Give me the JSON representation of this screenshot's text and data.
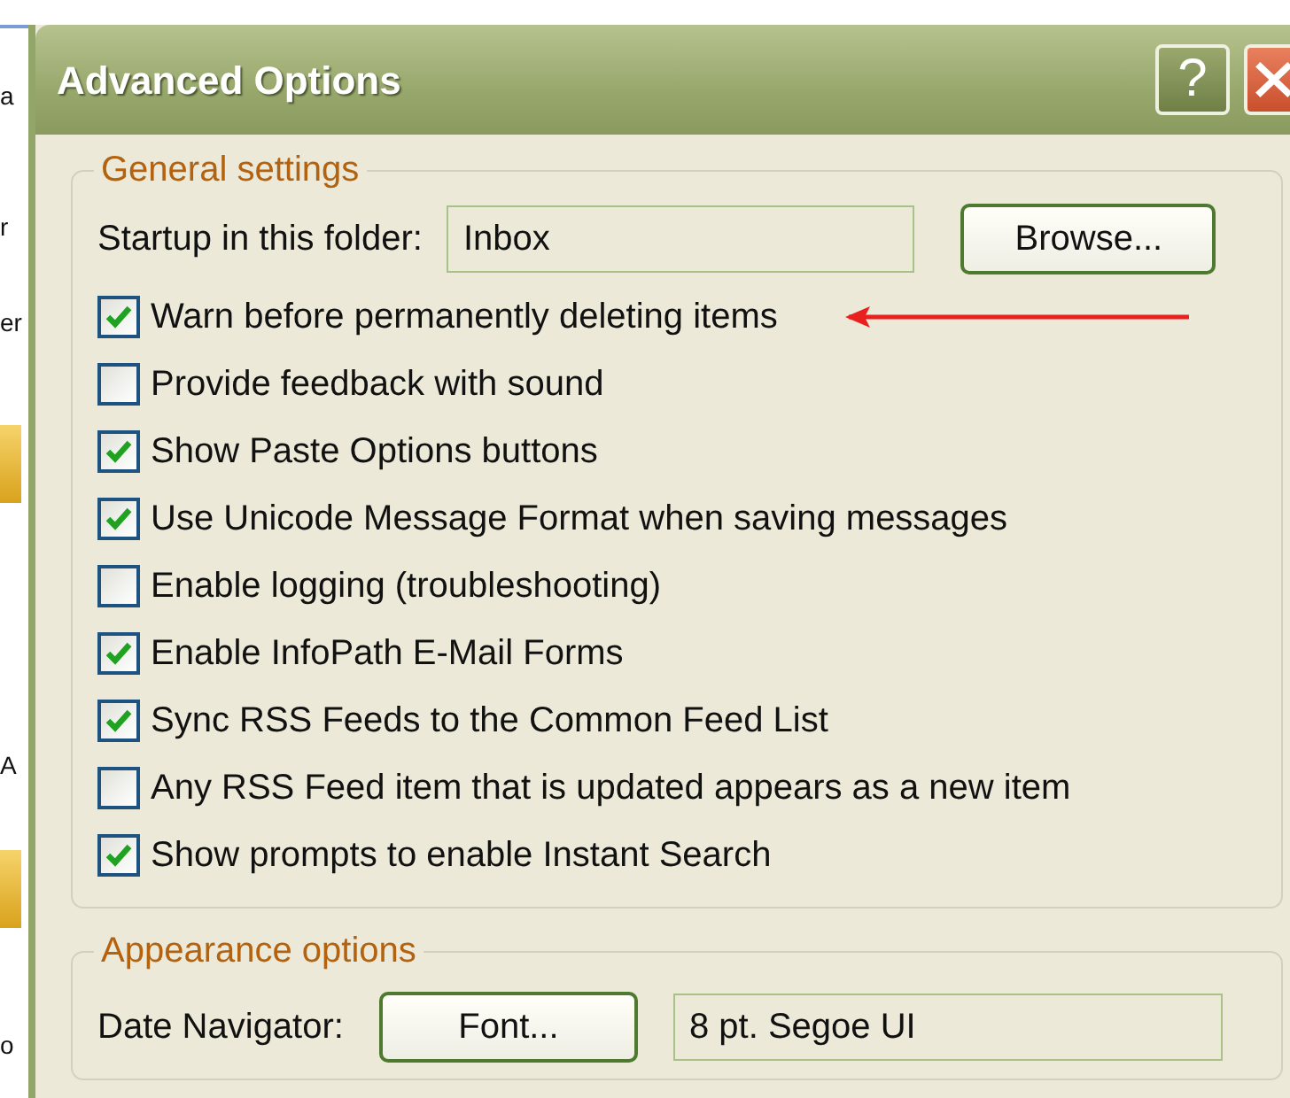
{
  "background_fragments": [
    "a",
    "r",
    "er",
    "A",
    "o"
  ],
  "window": {
    "title": "Advanced Options",
    "help": "?"
  },
  "general_settings": {
    "title": "General settings",
    "startup": {
      "label": "Startup in this folder:",
      "value": "Inbox",
      "button": "Browse..."
    },
    "options": [
      {
        "label": "Warn before permanently deleting items",
        "checked": true
      },
      {
        "label": "Provide feedback with sound",
        "checked": false
      },
      {
        "label": "Show Paste Options buttons",
        "checked": true
      },
      {
        "label": "Use Unicode Message Format when saving messages",
        "checked": true
      },
      {
        "label": "Enable logging (troubleshooting)",
        "checked": false
      },
      {
        "label": "Enable InfoPath E-Mail Forms",
        "checked": true
      },
      {
        "label": "Sync RSS Feeds to the Common Feed List",
        "checked": true
      },
      {
        "label": "Any RSS Feed item that is updated appears as a new item",
        "checked": false
      },
      {
        "label": "Show prompts to enable Instant Search",
        "checked": true
      }
    ]
  },
  "appearance_options": {
    "title": "Appearance options",
    "date_navigator": {
      "label": "Date Navigator:",
      "button": "Font...",
      "value": "8 pt. Segoe UI"
    }
  }
}
